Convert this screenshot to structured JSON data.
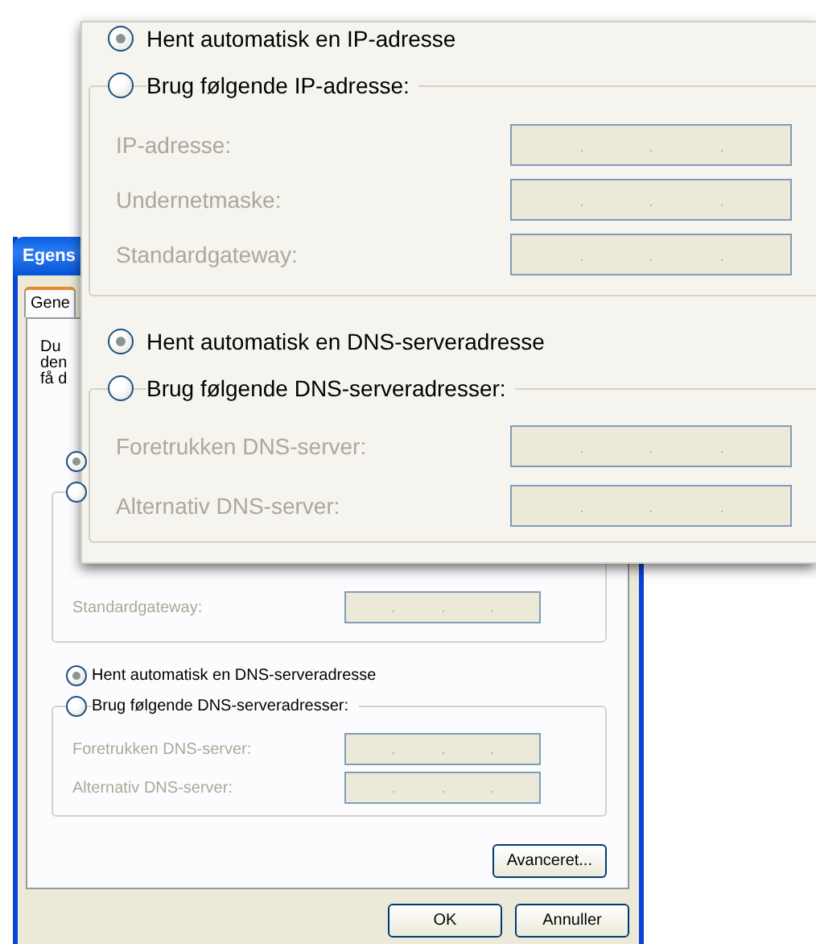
{
  "background_dialog": {
    "title": "Egens",
    "tabs": [
      {
        "label": "Gene",
        "selected": true
      }
    ],
    "intro_lines": [
      "Du",
      "den",
      "få d"
    ],
    "ip_options": [
      {
        "selected": true
      },
      {
        "selected": false
      }
    ],
    "ip_fields": [
      {
        "label": "Standardgateway:",
        "disabled": true
      }
    ],
    "dns_options": [
      {
        "label": "Hent automatisk en DNS-serveradresse",
        "selected": true
      },
      {
        "label": "Brug følgende DNS-serveradresser:",
        "selected": false
      }
    ],
    "dns_fields": [
      {
        "label": "Foretrukken DNS-server:",
        "disabled": true
      },
      {
        "label": "Alternativ DNS-server:",
        "disabled": true
      }
    ],
    "advanced_button": "Avanceret...",
    "buttons": [
      "OK",
      "Annuller"
    ]
  },
  "magnified_view": {
    "ip_options": [
      {
        "label": "Hent automatisk en IP-adresse",
        "selected": true
      },
      {
        "label": "Brug følgende IP-adresse:",
        "selected": false
      }
    ],
    "ip_fields": [
      {
        "label": "IP-adresse:",
        "disabled": true
      },
      {
        "label": "Undernetmaske:",
        "disabled": true
      },
      {
        "label": "Standardgateway:",
        "disabled": true
      }
    ],
    "dns_options": [
      {
        "label": "Hent automatisk en DNS-serveradresse",
        "selected": true
      },
      {
        "label": "Brug følgende DNS-serveradresser:",
        "selected": false
      }
    ],
    "dns_fields": [
      {
        "label": "Foretrukken DNS-server:",
        "disabled": true
      },
      {
        "label": "Alternativ DNS-server:",
        "disabled": true
      }
    ]
  }
}
